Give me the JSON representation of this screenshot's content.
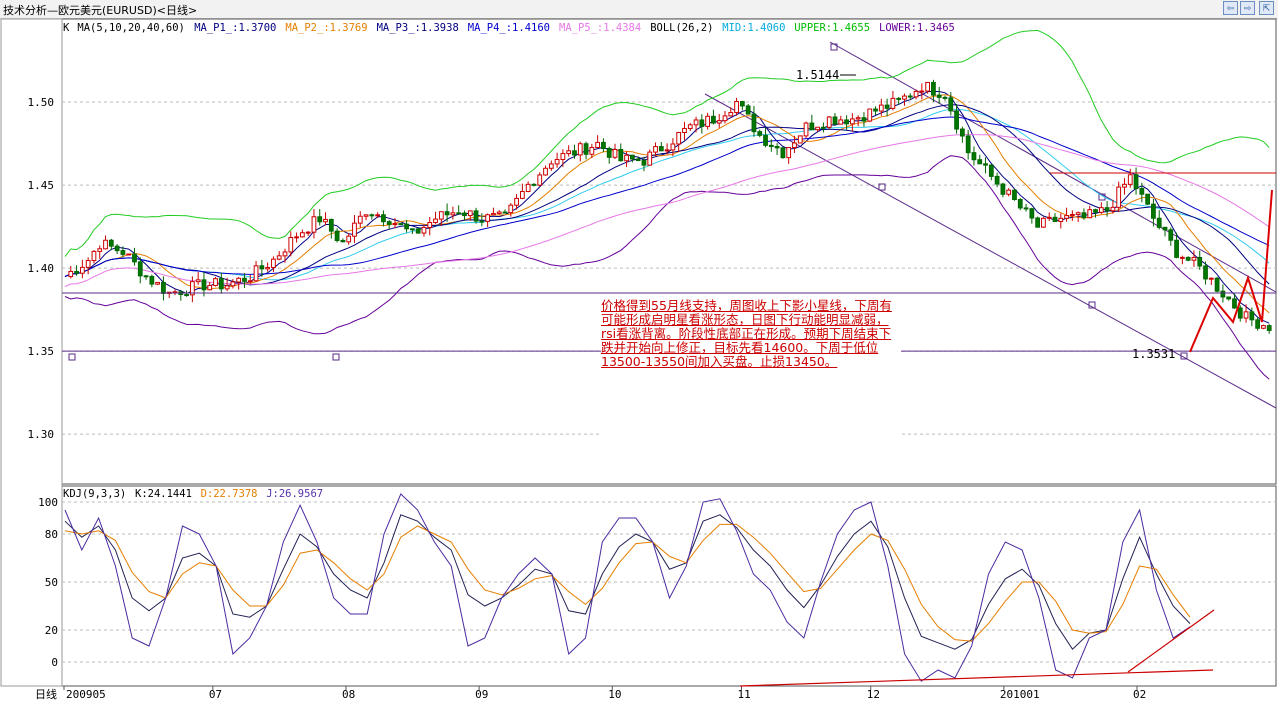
{
  "window": {
    "title": "技术分析—欧元美元(EURUSD)<日线>",
    "buttons": [
      "⇦",
      "⇨",
      "⇱"
    ]
  },
  "main_legend": [
    {
      "text": "K",
      "color": "#000000"
    },
    {
      "text": "MA(5,10,20,40,60)",
      "color": "#000000"
    },
    {
      "text": "MA_P1_:1.3700",
      "color": "#000080"
    },
    {
      "text": "MA_P2_:1.3769",
      "color": "#e67e00"
    },
    {
      "text": "MA_P3_:1.3938",
      "color": "#000080"
    },
    {
      "text": "MA_P4_:1.4160",
      "color": "#0000cc"
    },
    {
      "text": "MA_P5_:1.4384",
      "color": "#e678e6"
    },
    {
      "text": "BOLL(26,2)",
      "color": "#000000"
    },
    {
      "text": "MID:1.4060",
      "color": "#00aadd"
    },
    {
      "text": "UPPER:1.4655",
      "color": "#00bb00"
    },
    {
      "text": "LOWER:1.3465",
      "color": "#660099"
    }
  ],
  "kdj_legend": [
    {
      "text": "KDJ(9,3,3)",
      "color": "#000000"
    },
    {
      "text": "K:24.1441",
      "color": "#000000"
    },
    {
      "text": "D:22.7378",
      "color": "#e67e00"
    },
    {
      "text": "J:26.9567",
      "color": "#5533aa"
    }
  ],
  "annotation": {
    "text": "价格得到55月线支持，周图收上下影小星线，下周有可能形成启明星看涨形态，日图下行动能明显减弱，rsi看涨背离。阶段性底部正在形成。预期下周结束下跌并开始向上修正，目标先看14600。下周于低位13500-13550间加入买盘。止损13450。"
  },
  "x_axis_label": "日线",
  "chart_data": [
    {
      "type": "candlestick",
      "title": "技术分析—欧元美元(EURUSD)<日线>",
      "ylim": [
        1.27,
        1.55
      ],
      "yticks": [
        "1.50",
        "1.45",
        "1.40",
        "1.35",
        "1.30"
      ],
      "grid": true,
      "x_tick_labels": [
        "200905",
        "07",
        "08",
        "09",
        "10",
        "11",
        "12",
        "201001",
        "02"
      ],
      "price_labels": [
        {
          "text": "1.5144",
          "value": 1.5144
        },
        {
          "text": "1.3531",
          "value": 1.3531
        }
      ],
      "support_levels": [
        1.385,
        1.35
      ],
      "series": [
        {
          "name": "MA_P1_",
          "last": 1.37
        },
        {
          "name": "MA_P2_",
          "last": 1.3769
        },
        {
          "name": "MA_P3_",
          "last": 1.3938
        },
        {
          "name": "MA_P4_",
          "last": 1.416
        },
        {
          "name": "MA_P5_",
          "last": 1.4384
        },
        {
          "name": "MID",
          "last": 1.406
        },
        {
          "name": "UPPER",
          "last": 1.4655
        },
        {
          "name": "LOWER",
          "last": 1.3465
        }
      ],
      "price_path": [
        [
          0,
          1.395
        ],
        [
          4,
          1.405
        ],
        [
          6,
          1.415
        ],
        [
          10,
          1.41
        ],
        [
          14,
          1.395
        ],
        [
          18,
          1.385
        ],
        [
          24,
          1.39
        ],
        [
          28,
          1.39
        ],
        [
          32,
          1.395
        ],
        [
          36,
          1.405
        ],
        [
          40,
          1.42
        ],
        [
          44,
          1.43
        ],
        [
          48,
          1.415
        ],
        [
          52,
          1.435
        ],
        [
          56,
          1.43
        ],
        [
          60,
          1.42
        ],
        [
          64,
          1.43
        ],
        [
          68,
          1.435
        ],
        [
          72,
          1.43
        ],
        [
          76,
          1.43
        ],
        [
          80,
          1.45
        ],
        [
          84,
          1.465
        ],
        [
          88,
          1.47
        ],
        [
          92,
          1.475
        ],
        [
          96,
          1.465
        ],
        [
          100,
          1.465
        ],
        [
          104,
          1.475
        ],
        [
          108,
          1.485
        ],
        [
          112,
          1.49
        ],
        [
          116,
          1.5
        ],
        [
          120,
          1.48
        ],
        [
          124,
          1.47
        ],
        [
          128,
          1.485
        ],
        [
          132,
          1.49
        ],
        [
          136,
          1.49
        ],
        [
          140,
          1.495
        ],
        [
          144,
          1.5
        ],
        [
          148,
          1.51
        ],
        [
          152,
          1.505
        ],
        [
          156,
          1.47
        ],
        [
          160,
          1.455
        ],
        [
          164,
          1.44
        ],
        [
          168,
          1.425
        ],
        [
          172,
          1.43
        ],
        [
          176,
          1.43
        ],
        [
          180,
          1.435
        ],
        [
          184,
          1.455
        ],
        [
          188,
          1.43
        ],
        [
          192,
          1.41
        ],
        [
          196,
          1.4
        ],
        [
          200,
          1.385
        ],
        [
          204,
          1.37
        ],
        [
          208,
          1.365
        ]
      ]
    },
    {
      "type": "line",
      "title": "KDJ(9,3,3)",
      "ylim": [
        -15,
        110
      ],
      "yticks": [
        "100",
        "80",
        "50",
        "20",
        "0"
      ],
      "grid": true,
      "series": [
        {
          "name": "K",
          "last": 24.1441,
          "values": [
            88,
            78,
            85,
            70,
            40,
            32,
            40,
            65,
            68,
            60,
            30,
            28,
            35,
            58,
            80,
            72,
            55,
            45,
            40,
            62,
            92,
            88,
            78,
            70,
            42,
            35,
            40,
            48,
            58,
            55,
            32,
            30,
            55,
            72,
            80,
            75,
            58,
            62,
            88,
            92,
            84,
            70,
            60,
            45,
            34,
            48,
            66,
            80,
            88,
            72,
            40,
            16,
            12,
            8,
            14,
            36,
            52,
            58,
            48,
            24,
            8,
            18,
            20,
            52,
            78,
            55,
            35,
            24
          ]
        },
        {
          "name": "D",
          "last": 22.7378,
          "values": [
            82,
            80,
            82,
            76,
            56,
            44,
            40,
            55,
            62,
            60,
            45,
            35,
            35,
            48,
            68,
            70,
            62,
            52,
            45,
            55,
            78,
            85,
            80,
            75,
            58,
            45,
            42,
            46,
            52,
            54,
            44,
            36,
            46,
            62,
            74,
            75,
            66,
            62,
            76,
            86,
            86,
            78,
            68,
            56,
            44,
            46,
            58,
            70,
            80,
            76,
            58,
            36,
            22,
            14,
            13,
            24,
            38,
            50,
            50,
            38,
            20,
            18,
            19,
            36,
            60,
            58,
            42,
            28
          ]
        },
        {
          "name": "J",
          "last": 26.9567,
          "values": [
            95,
            70,
            90,
            60,
            15,
            10,
            40,
            85,
            80,
            60,
            5,
            15,
            35,
            75,
            98,
            75,
            40,
            30,
            30,
            80,
            105,
            95,
            75,
            60,
            10,
            15,
            40,
            55,
            65,
            55,
            5,
            15,
            75,
            90,
            90,
            75,
            40,
            60,
            100,
            102,
            82,
            55,
            45,
            25,
            15,
            50,
            80,
            95,
            100,
            60,
            5,
            -12,
            -5,
            -10,
            10,
            55,
            75,
            70,
            40,
            -5,
            -10,
            15,
            20,
            75,
            95,
            45,
            15,
            22
          ]
        }
      ],
      "trend_lines": [
        {
          "from": [
            0,
            -15
          ],
          "to": [
            1,
            -5
          ]
        },
        {
          "from": [
            0,
            -5
          ],
          "to": [
            1,
            35
          ]
        }
      ]
    }
  ]
}
